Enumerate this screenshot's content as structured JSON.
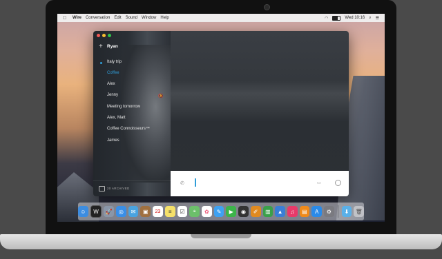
{
  "menubar": {
    "apple": "",
    "items": [
      "Wire",
      "Conversation",
      "Edit",
      "Sound",
      "Window",
      "Help"
    ],
    "clock": "Wed 10:16"
  },
  "window": {
    "user_name": "Ryan",
    "conversations": [
      {
        "label": "Italy trip",
        "unread": true,
        "active": false
      },
      {
        "label": "Coffee",
        "unread": false,
        "active": true
      },
      {
        "label": "Alex",
        "unread": false,
        "active": false
      },
      {
        "label": "Jenny",
        "unread": false,
        "active": false,
        "muted": true
      },
      {
        "label": "Meeting tomorrow",
        "unread": false,
        "active": false
      },
      {
        "label": "Alex, Matt",
        "unread": false,
        "active": false
      },
      {
        "label": "Coffee Connoisseurs™",
        "unread": false,
        "active": false
      },
      {
        "label": "James",
        "unread": false,
        "active": false
      }
    ],
    "archived_label": "20 ARCHIVED",
    "accent_color": "#2f9dd8"
  },
  "dock": {
    "icons": [
      "finder-icon",
      "wire-icon",
      "launchpad-icon",
      "safari-icon",
      "mail-icon",
      "contacts-icon",
      "calendar-icon",
      "notes-icon",
      "reminders-icon",
      "maps-icon",
      "photos-icon",
      "messages-icon",
      "facetime-icon",
      "photobooth-icon",
      "pages-icon",
      "numbers-icon",
      "keynote-icon",
      "itunes-icon",
      "ibooks-icon",
      "appstore-icon",
      "system-preferences-icon",
      "downloads-icon",
      "trash-icon"
    ],
    "calendar_day": "23"
  }
}
